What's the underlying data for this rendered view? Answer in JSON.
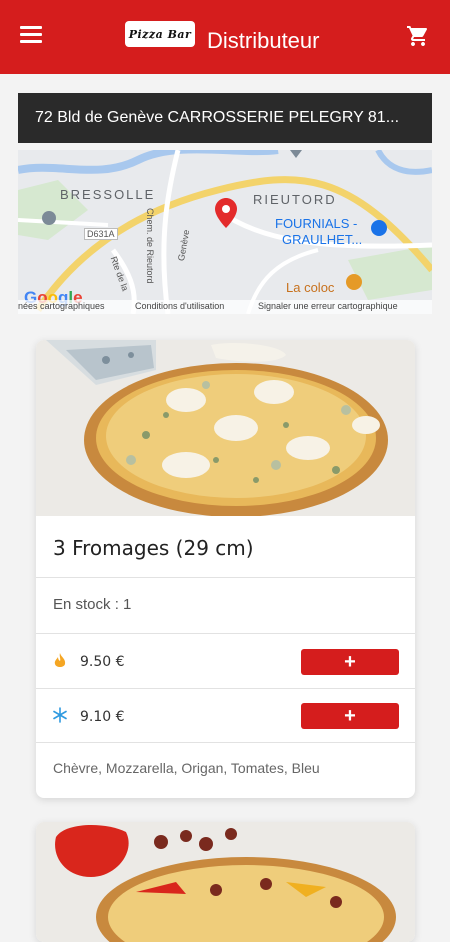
{
  "header": {
    "logo_text": "Pizza Bar",
    "title": "Distributeur"
  },
  "address": {
    "text": "72 Bld de Genève CARROSSERIE PELEGRY 81..."
  },
  "map": {
    "places": [
      "BRESSOLLE",
      "RIEUTORD"
    ],
    "poi_fournials_line1": "FOURNIALS -",
    "poi_fournials_line2": "GRAULHET...",
    "poi_coloc": "La coloc",
    "road_label": "D631A",
    "street_1": "Rte de la",
    "street_2": "Chem. de Rieutord",
    "street_3": "Genève",
    "google": "Google",
    "footer_1": "nées cartographiques",
    "footer_2": "Conditions d'utilisation",
    "footer_3": "Signaler une erreur cartographique"
  },
  "product": {
    "name": "3 Fromages (29 cm)",
    "stock_text": "En stock : 1",
    "price_hot": "9.50  €",
    "price_frozen": "9.10  €",
    "add_label": "+",
    "ingredients": "Chèvre, Mozzarella, Origan, Tomates, Bleu"
  },
  "colors": {
    "brand_red": "#d51d1d",
    "hot_icon": "#f5a623",
    "frozen_icon": "#2f9ae0"
  },
  "icons": {
    "menu": "menu-icon",
    "cart": "cart-icon",
    "hot": "flame-icon",
    "frozen": "snowflake-icon",
    "map_pin": "map-pin-icon"
  }
}
